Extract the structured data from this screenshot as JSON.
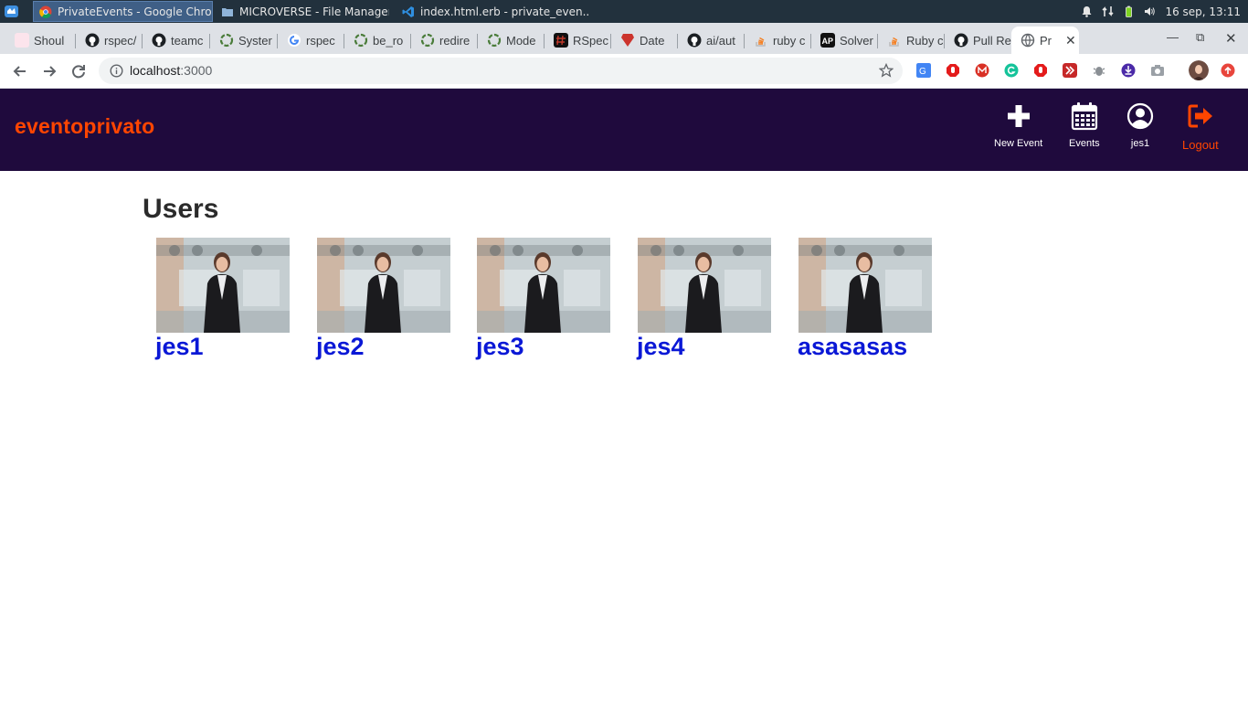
{
  "taskbar": {
    "windows": [
      {
        "title": "PrivateEvents - Google Chro...",
        "active": true
      },
      {
        "title": "MICROVERSE - File Manager",
        "active": false
      },
      {
        "title": "index.html.erb - private_even...",
        "active": false
      }
    ],
    "clock": "16 sep, 13:11"
  },
  "browser": {
    "tabs": [
      {
        "label": "Shoul"
      },
      {
        "label": "rspec/"
      },
      {
        "label": "teamc"
      },
      {
        "label": "Syster"
      },
      {
        "label": "rspec"
      },
      {
        "label": "be_ro"
      },
      {
        "label": "redire"
      },
      {
        "label": "Mode"
      },
      {
        "label": "RSpec"
      },
      {
        "label": "Date"
      },
      {
        "label": "ai/aut"
      },
      {
        "label": "ruby c"
      },
      {
        "label": "Solver"
      },
      {
        "label": "Ruby c"
      },
      {
        "label": "Pull Re"
      },
      {
        "label": "Pr"
      }
    ],
    "url_host": "localhost",
    "url_port": ":3000"
  },
  "app": {
    "brand": "eventoprivato",
    "nav": {
      "new_event": "New Event",
      "events": "Events",
      "profile": "jes1",
      "logout": "Logout"
    },
    "colors": {
      "navbar_bg": "#1f0a3d",
      "brand": "#ff4500",
      "link": "#0a18d6"
    }
  },
  "main": {
    "title": "Users",
    "users": [
      {
        "name": "jes1"
      },
      {
        "name": "jes2"
      },
      {
        "name": "jes3"
      },
      {
        "name": "jes4"
      },
      {
        "name": "asasasas"
      }
    ]
  }
}
